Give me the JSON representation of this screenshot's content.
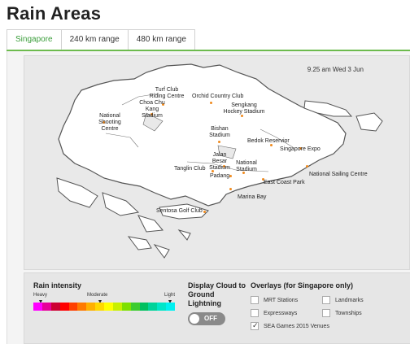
{
  "page": {
    "title": "Rain Areas"
  },
  "tabs": [
    {
      "label": "Singapore",
      "active": true
    },
    {
      "label": "240 km range",
      "active": false
    },
    {
      "label": "480 km range",
      "active": false
    }
  ],
  "map": {
    "timestamp": "9.25 am Wed 3 Jun",
    "locations": [
      "Turf Club Riding Centre",
      "Choa Chu Kang Stadium",
      "Orchid Country Club",
      "Sengkang Hockey Stadium",
      "National Shooting Centre",
      "Bishan Stadium",
      "Bedok Reservior",
      "Singapore Expo",
      "Jalan Besar Stadium",
      "Tanglin Club",
      "National Stadium",
      "Padang",
      "National Sailing Centre",
      "East Coast Park",
      "Marina Bay",
      "Sentosa Golf Club"
    ]
  },
  "legend": {
    "rain_intensity": {
      "title": "Rain intensity",
      "heavy": "Heavy",
      "moderate": "Moderate",
      "light": "Light",
      "colors": [
        "#ff00ff",
        "#e60099",
        "#cc0033",
        "#ff0000",
        "#ff4000",
        "#ff7a00",
        "#ffb000",
        "#ffd800",
        "#ffff00",
        "#c8f000",
        "#7ee000",
        "#3ccc2e",
        "#00c060",
        "#00d39a",
        "#00e6c8",
        "#00f0f0"
      ]
    },
    "display_cloud": {
      "title": "Display Cloud to Ground Lightning",
      "toggle": "OFF"
    },
    "overlays": {
      "title": "Overlays (for Singapore only)",
      "items": [
        {
          "label": "MRT Stations",
          "checked": false
        },
        {
          "label": "Landmarks",
          "checked": false
        },
        {
          "label": "Expressways",
          "checked": false
        },
        {
          "label": "Townships",
          "checked": false
        },
        {
          "label": "SEA Games 2015 Venues",
          "checked": true
        }
      ]
    }
  }
}
